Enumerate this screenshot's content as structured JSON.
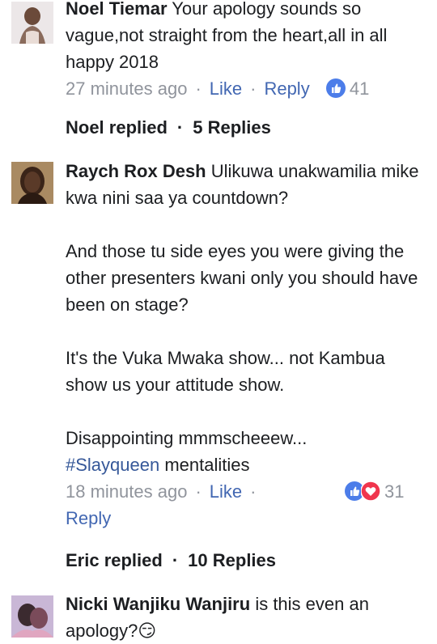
{
  "comments": [
    {
      "author": "Noel Tiemar",
      "text": "Your apology sounds so vague,not straight from the heart,all in all happy 2018",
      "time": "27 minutes ago",
      "like_label": "Like",
      "reply_label": "Reply",
      "reaction_count": "41",
      "reactions": [
        "like-icon"
      ]
    },
    {
      "author": "Raych Rox Desh",
      "paragraphs": [
        "Ulikuwa unakwamilia mike kwa nini saa ya countdown?",
        "And those tu side eyes you were giving the other presenters kwani only you should have been on stage?",
        "It's the Vuka Mwaka show... not Kambua show us your attitude show.",
        "Disappointing mmmscheeew..."
      ],
      "hashtag": "#Slayqueen",
      "hashtag_rest": "mentalities",
      "time": "18 minutes ago",
      "like_label": "Like",
      "reply_label": "Reply",
      "reaction_count": "31",
      "reactions": [
        "like-icon",
        "love-icon"
      ]
    },
    {
      "author": "Nicki Wanjiku Wanjiru",
      "text": "is this even an apology?😏"
    }
  ],
  "reply_summaries": [
    {
      "name": "Noel replied",
      "count": "5 Replies"
    },
    {
      "name": "Eric replied",
      "count": "10 Replies"
    }
  ],
  "separator": "·",
  "colors": {
    "link": "#4267b2",
    "meta": "#90949c",
    "like": "#4c7de9",
    "love": "#f0354d"
  }
}
